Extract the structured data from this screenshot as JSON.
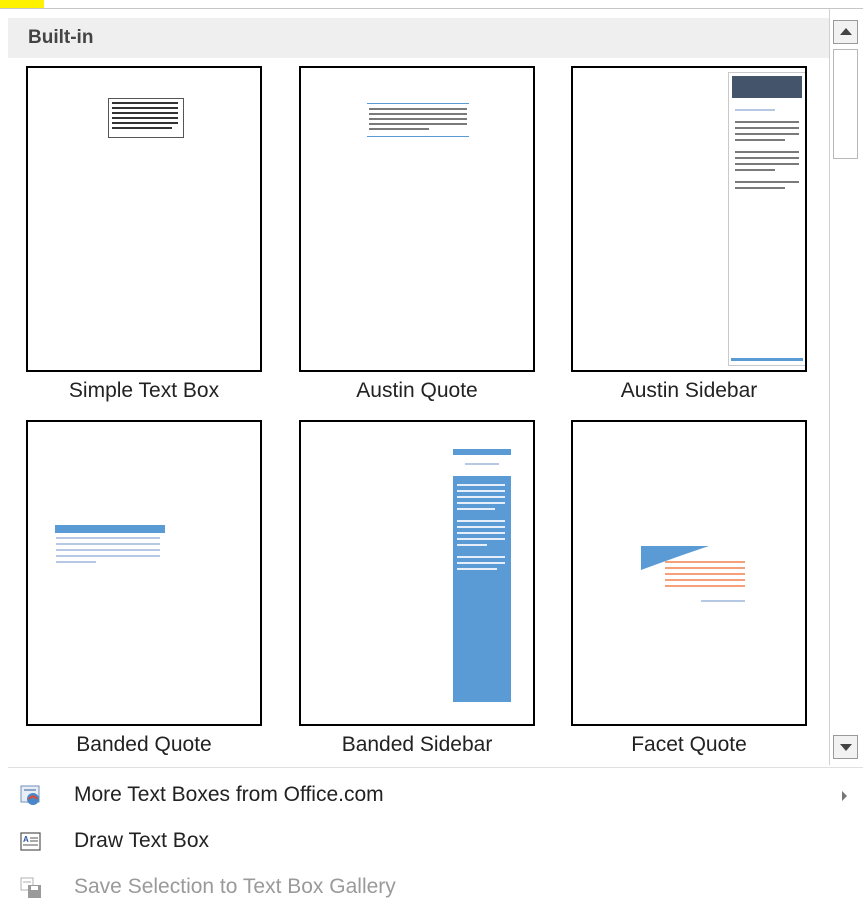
{
  "gallery": {
    "section_title": "Built-in",
    "items": [
      {
        "label": "Simple Text Box"
      },
      {
        "label": "Austin Quote"
      },
      {
        "label": "Austin Sidebar"
      },
      {
        "label": "Banded Quote"
      },
      {
        "label": "Banded Sidebar"
      },
      {
        "label": "Facet Quote"
      }
    ]
  },
  "menu": {
    "items": [
      {
        "label": "More Text Boxes from Office.com",
        "icon": "office-com-icon",
        "has_submenu": true,
        "enabled": true
      },
      {
        "label": "Draw Text Box",
        "icon": "draw-text-box-icon",
        "has_submenu": false,
        "enabled": true
      },
      {
        "label": "Save Selection to Text Box Gallery",
        "icon": "save-selection-icon",
        "has_submenu": false,
        "enabled": false
      }
    ]
  },
  "colors": {
    "accent_blue": "#5b9bd5",
    "header_bg": "#efefef",
    "highlight": "#fff200",
    "disabled_text": "#9a9a9a"
  }
}
